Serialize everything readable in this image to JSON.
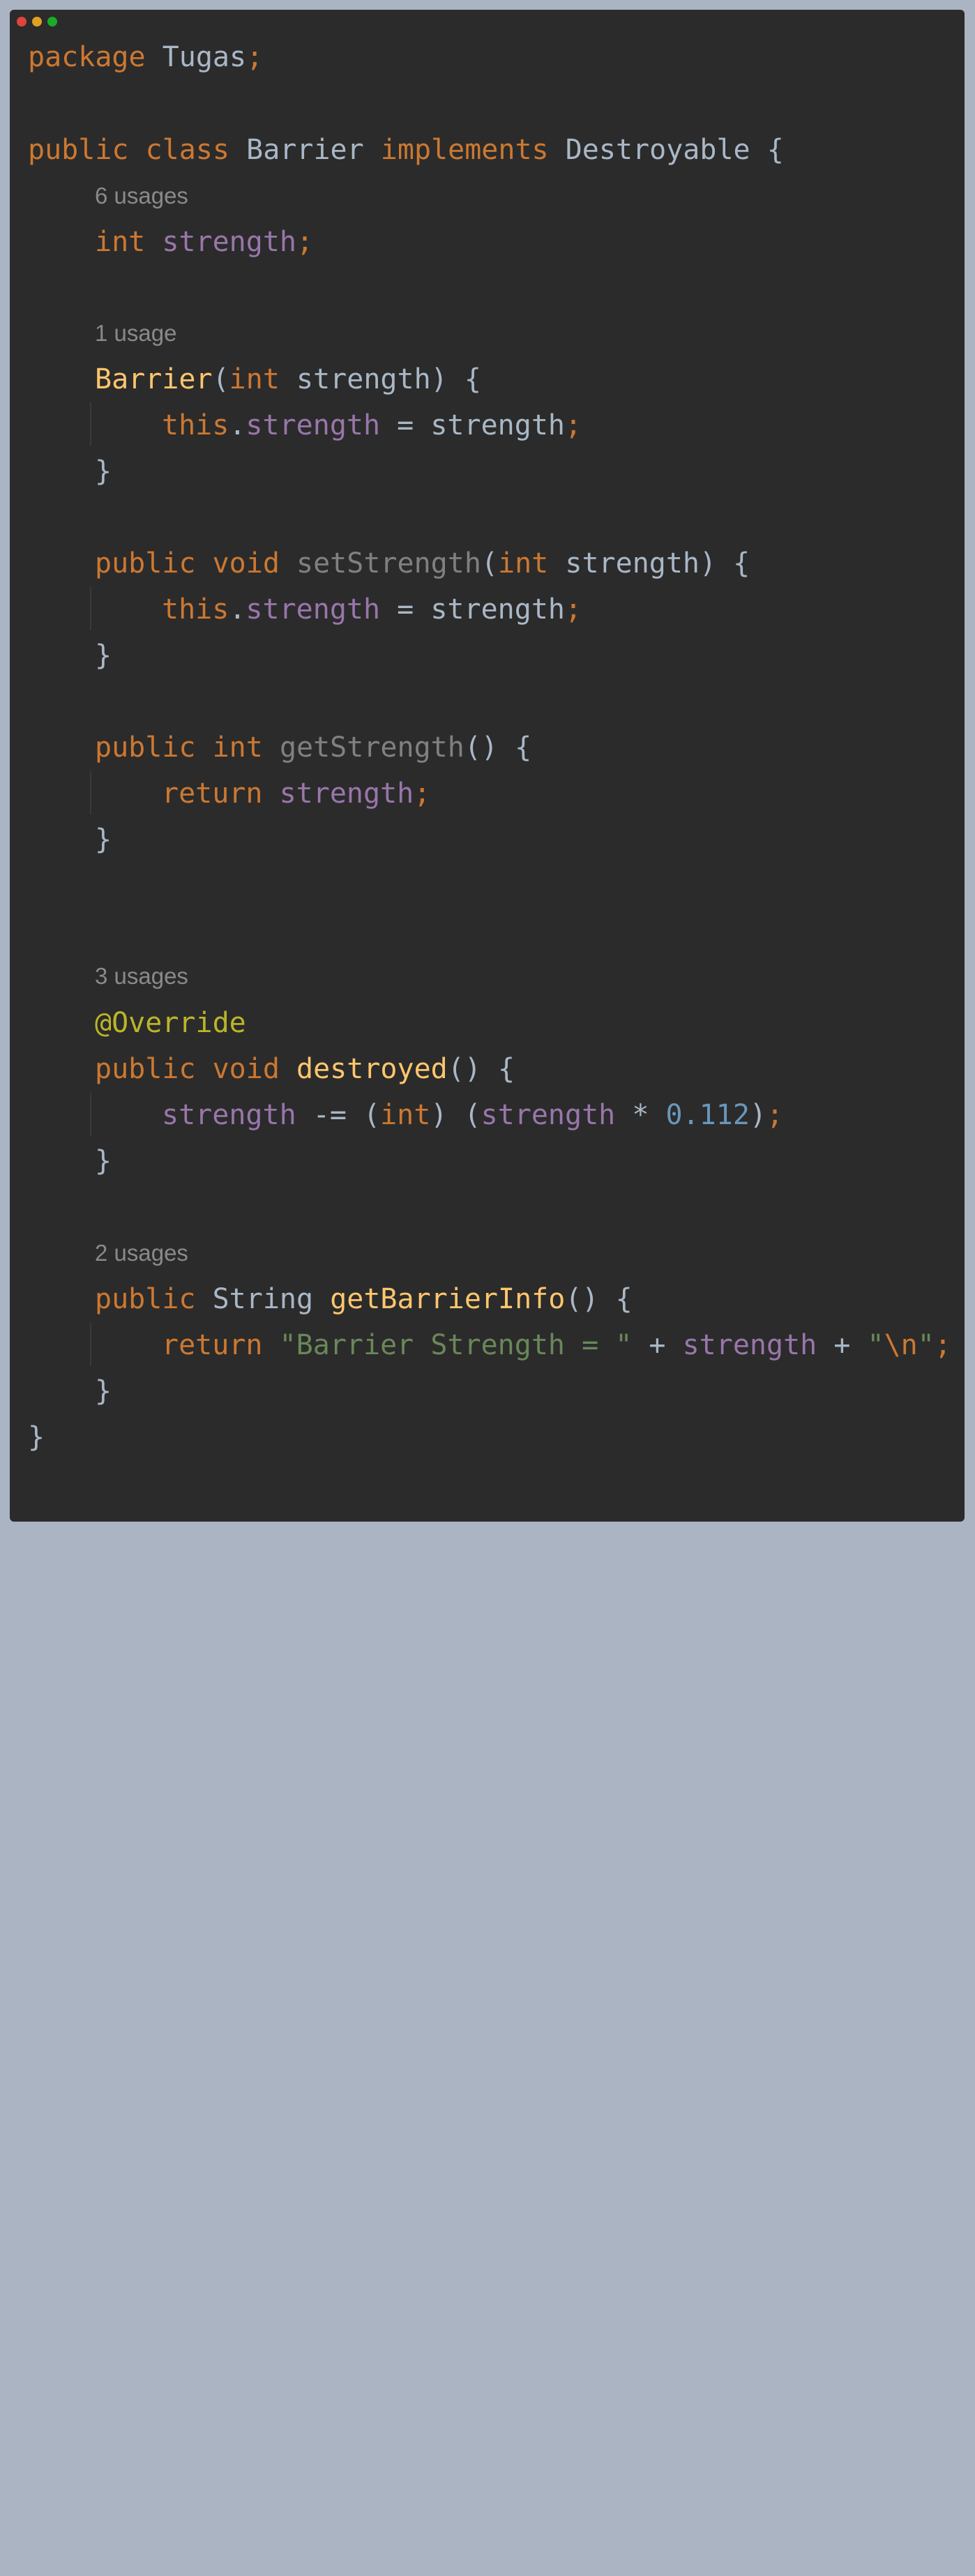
{
  "window": {
    "controls": [
      "#e0443e",
      "#dea123",
      "#1aab29"
    ]
  },
  "code": {
    "package_kw": "package",
    "package_name": "Tugas",
    "semicolon": ";",
    "public": "public",
    "class": "class",
    "class_name": "Barrier",
    "implements": "implements",
    "interface_name": "Destroyable",
    "open_brace": "{",
    "close_brace": "}",
    "usage_hint_field": "6 usages",
    "int": "int",
    "field_name": "strength",
    "usage_hint_ctor": "1 usage",
    "ctor_name": "Barrier",
    "open_paren": "(",
    "close_paren_brace": ") {",
    "param_name": "strength",
    "this": "this",
    "dot": ".",
    "assign": " = ",
    "void": "void",
    "set_name": "setStrength",
    "get_name": "getStrength",
    "empty_params_brace": "() {",
    "return": "return",
    "usage_hint_destroyed": "3 usages",
    "override": "@Override",
    "destroyed_name": "destroyed",
    "minus_assign": " -= ",
    "cast_open": "(",
    "cast_close": ") (",
    "times": " * ",
    "number": "0.112",
    "close_paren": ")",
    "usage_hint_info": "2 usages",
    "string_type": "String",
    "info_name": "getBarrierInfo",
    "str_literal": "\"Barrier Strength = \"",
    "plus": " + ",
    "str_quote_open": "\"",
    "escape_n": "\\n",
    "str_quote_close": "\""
  }
}
